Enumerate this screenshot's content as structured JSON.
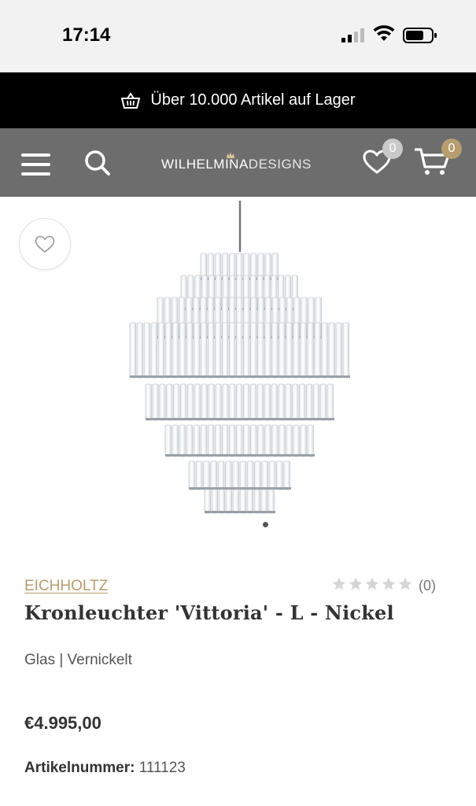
{
  "status_bar": {
    "time": "17:14"
  },
  "promo": {
    "text": "Über 10.000 Artikel auf Lager"
  },
  "header": {
    "logo_part1": "WILHELMINA",
    "logo_part2": "DESIGNS",
    "wishlist_count": "0",
    "cart_count": "0"
  },
  "product": {
    "brand": "EICHHOLTZ",
    "rating": 0,
    "rating_max": 5,
    "rating_count": "(0)",
    "title": "Kronleuchter 'Vittoria' - L - Nickel",
    "material": "Glas | Vernickelt",
    "price": "€4.995,00",
    "sku_label": "Artikelnummer:",
    "sku_value": "111123"
  },
  "colors": {
    "accent": "#b89d6f",
    "header_bg": "#6d6d6d",
    "promo_bg": "#000000"
  }
}
